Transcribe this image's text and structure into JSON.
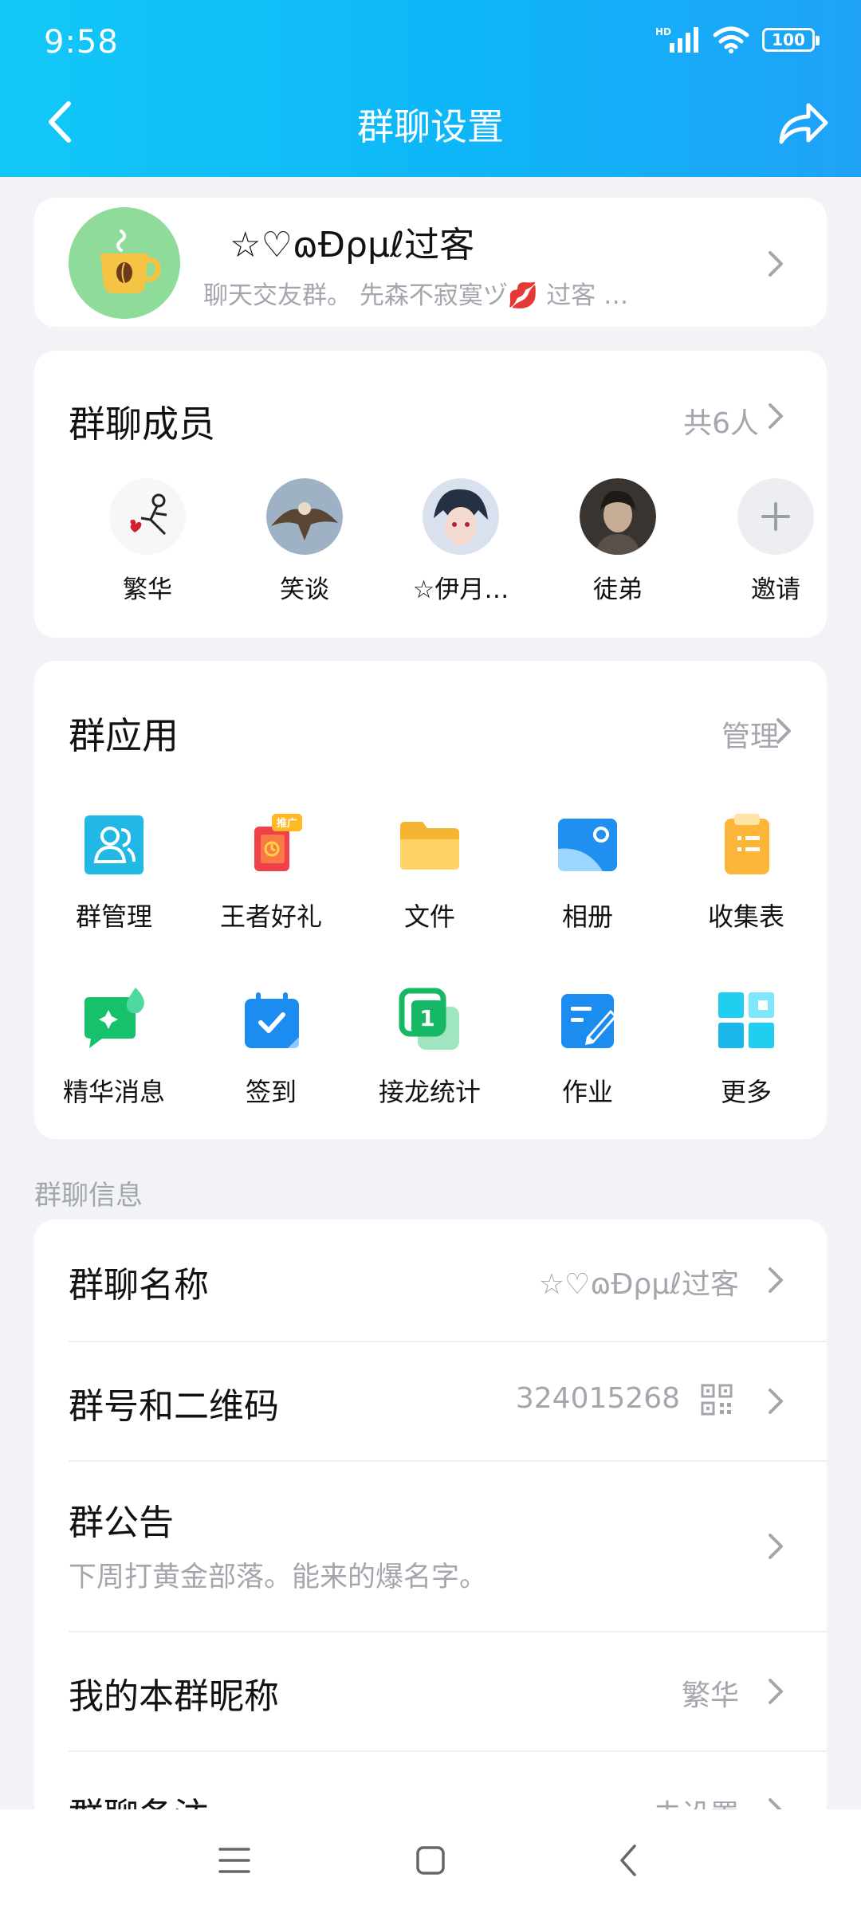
{
  "status_bar": {
    "time": "9:58",
    "network": "HD",
    "battery": "100"
  },
  "header": {
    "title": "群聊设置"
  },
  "group": {
    "name": "☆♡ɷĐρμℓ过客",
    "members_preview": "聊天交友群。  先森不寂寞ヅ💋  过客  …"
  },
  "members": {
    "title": "群聊成员",
    "count": "共6人",
    "list": [
      {
        "name": "繁华"
      },
      {
        "name": "笑谈"
      },
      {
        "name": "☆伊月…"
      },
      {
        "name": "徒弟"
      }
    ],
    "invite": "邀请"
  },
  "apps": {
    "title": "群应用",
    "manage": "管理",
    "badge": "推广",
    "items": [
      {
        "label": "群管理",
        "icon": "group-manage-icon"
      },
      {
        "label": "王者好礼",
        "icon": "gift-icon"
      },
      {
        "label": "文件",
        "icon": "folder-icon"
      },
      {
        "label": "相册",
        "icon": "album-icon"
      },
      {
        "label": "收集表",
        "icon": "clipboard-icon"
      },
      {
        "label": "精华消息",
        "icon": "essence-message-icon"
      },
      {
        "label": "签到",
        "icon": "calendar-checkin-icon"
      },
      {
        "label": "接龙统计",
        "icon": "chain-stats-icon"
      },
      {
        "label": "作业",
        "icon": "homework-icon"
      },
      {
        "label": "更多",
        "icon": "more-grid-icon"
      }
    ]
  },
  "info": {
    "section_label": "群聊信息",
    "name_label": "群聊名称",
    "name_value": "☆♡ɷĐρμℓ过客",
    "number_label": "群号和二维码",
    "number_value": "324015268",
    "notice_label": "群公告",
    "notice_value": "下周打黄金部落。能来的爆名字。",
    "nickname_label": "我的本群昵称",
    "nickname_value": "繁华",
    "remark_label": "群聊备注",
    "remark_value": "未设置"
  },
  "colors": {
    "header_start": "#12c8f8",
    "header_end": "#1fa2f8",
    "gray_text": "#a3a6ad",
    "background": "#f2f3f7"
  }
}
